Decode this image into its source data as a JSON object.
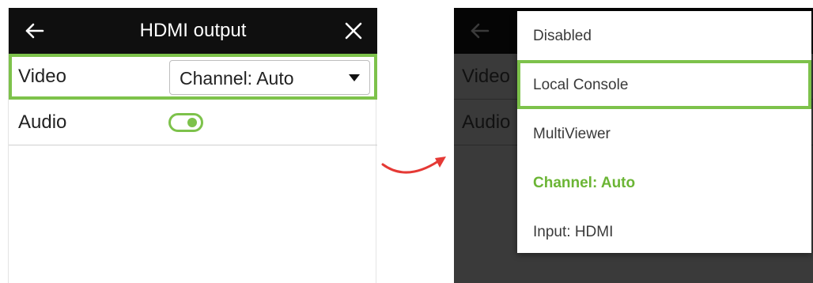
{
  "left": {
    "header": {
      "title": "HDMI output"
    },
    "rows": {
      "video": {
        "label": "Video",
        "select_value": "Channel: Auto"
      },
      "audio": {
        "label": "Audio",
        "toggle_on": true
      }
    }
  },
  "right": {
    "background_labels": {
      "video": "Video",
      "audio": "Audio"
    },
    "dropdown": {
      "options": [
        {
          "label": "Disabled"
        },
        {
          "label": "Local Console",
          "highlighted": true
        },
        {
          "label": "MultiViewer"
        },
        {
          "label": "Channel: Auto",
          "selected": true
        },
        {
          "label": "Input: HDMI"
        }
      ]
    }
  },
  "colors": {
    "accent": "#7dc24b",
    "header": "#0f0f0f",
    "arrow": "#e53935",
    "selected_text": "#6bb535"
  },
  "icons": {
    "back": "arrow-left-icon",
    "close": "close-icon",
    "transition": "curved-arrow-icon"
  }
}
